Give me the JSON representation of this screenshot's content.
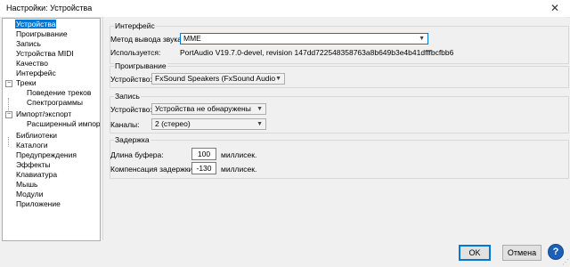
{
  "window": {
    "title": "Настройки:  Устройства",
    "close_glyph": "✕"
  },
  "tree": [
    {
      "label": "Устройства",
      "selected": true
    },
    {
      "label": "Проигрывание"
    },
    {
      "label": "Запись"
    },
    {
      "label": "Устройства MIDI"
    },
    {
      "label": "Качество"
    },
    {
      "label": "Интерфейс"
    },
    {
      "label": "Треки",
      "expander": "−"
    },
    {
      "label": "Поведение треков"
    },
    {
      "label": "Спектрограммы"
    },
    {
      "label": "Импорт/экспорт",
      "expander": "−"
    },
    {
      "label": "Расширенный импорт"
    },
    {
      "label": "Библиотеки"
    },
    {
      "label": "Каталоги"
    },
    {
      "label": "Предупреждения"
    },
    {
      "label": "Эффекты"
    },
    {
      "label": "Клавиатура"
    },
    {
      "label": "Мышь"
    },
    {
      "label": "Модули"
    },
    {
      "label": "Приложение"
    }
  ],
  "interface": {
    "heading": "Интерфейс",
    "host_label": "Метод вывода звука:",
    "host_value": "MME",
    "uses_label": "Используется:",
    "uses_value": "PortAudio V19.7.0-devel, revision 147dd722548358763a8b649b3e4b41dfffbcfbb6"
  },
  "playback": {
    "heading": "Проигрывание",
    "device_label": "Устройство:",
    "device_value": "FxSound Speakers (FxSound Audio"
  },
  "recording": {
    "heading": "Запись",
    "device_label": "Устройство:",
    "device_value": "Устройства не обнаружены",
    "channels_label": "Каналы:",
    "channels_value": "2 (стерео)"
  },
  "latency": {
    "heading": "Задержка",
    "buffer_label": "Длина буфера:",
    "buffer_value": "100",
    "buffer_unit": "миллисек.",
    "comp_label": "Компенсация задержки:",
    "comp_value": "-130",
    "comp_unit": "миллисек."
  },
  "buttons": {
    "ok": "OK",
    "cancel": "Отмена",
    "help": "?"
  },
  "colors": {
    "accent": "#0078d7",
    "help_button": "#1c5fb8"
  }
}
